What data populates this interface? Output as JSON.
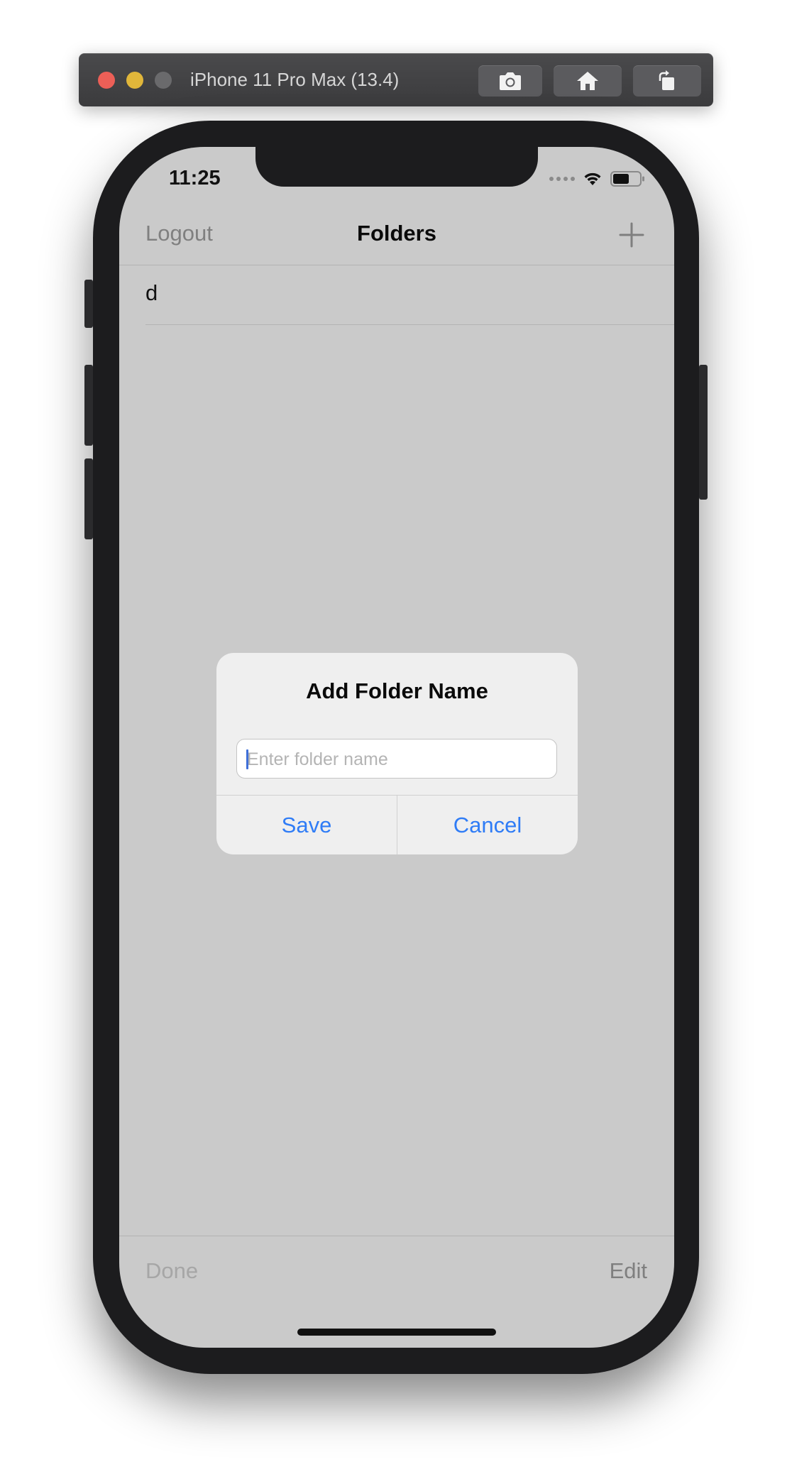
{
  "simulator": {
    "title": "iPhone 11 Pro Max (13.4)",
    "buttons": [
      "screenshot-icon",
      "home-icon",
      "rotate-icon"
    ]
  },
  "status_bar": {
    "time": "11:25",
    "icons": [
      "cellular-signal-icon",
      "wifi-icon",
      "battery-icon"
    ]
  },
  "nav": {
    "left": "Logout",
    "title": "Folders",
    "right_icon": "plus-icon"
  },
  "list": {
    "items": [
      "d"
    ]
  },
  "alert": {
    "title": "Add Folder Name",
    "input": {
      "value": "",
      "placeholder": "Enter folder name"
    },
    "save": "Save",
    "cancel": "Cancel"
  },
  "toolbar": {
    "left": "Done",
    "right": "Edit"
  },
  "colors": {
    "accent": "#2f7cf6",
    "dimmed_background": "#cacaca",
    "alert_background": "#efefef"
  }
}
